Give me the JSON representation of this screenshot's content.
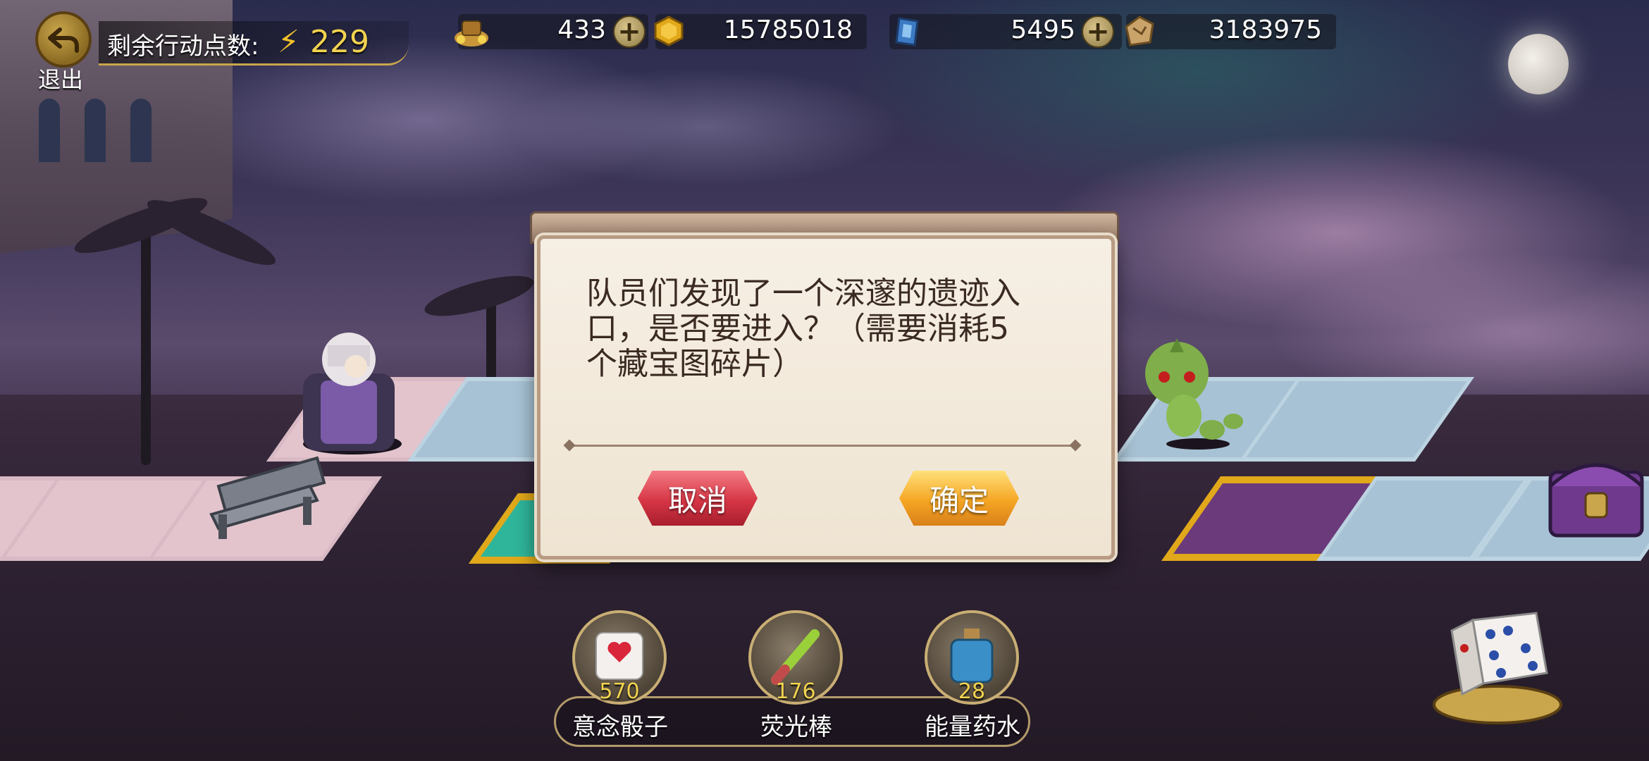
{
  "top_bar": {
    "back_label": "退出",
    "action_points_label": "剩余行动点数:",
    "action_points_value": "229"
  },
  "resources": [
    {
      "icon": "treasure-pile-icon",
      "value": "433",
      "has_plus": true
    },
    {
      "icon": "gold-coin-icon",
      "value": "15785018",
      "has_plus": false
    },
    {
      "icon": "blue-crystal-icon",
      "value": "5495",
      "has_plus": true
    },
    {
      "icon": "map-fragment-icon",
      "value": "3183975",
      "has_plus": false
    }
  ],
  "dialog": {
    "message": "队员们发现了一个深邃的遗迹入口，是否要进入？（需要消耗5个藏宝图碎片）",
    "cancel_label": "取消",
    "confirm_label": "确定"
  },
  "items": [
    {
      "icon": "heart-dice-icon",
      "count": "570",
      "name": "意念骰子"
    },
    {
      "icon": "glow-stick-icon",
      "count": "176",
      "name": "荧光棒"
    },
    {
      "icon": "potion-bottle-icon",
      "count": "28",
      "name": "能量药水"
    }
  ],
  "colors": {
    "gold": "#f2d350",
    "cancel": "#d63645",
    "confirm": "#f5a623",
    "dialog_bg": "#f6efe4"
  }
}
